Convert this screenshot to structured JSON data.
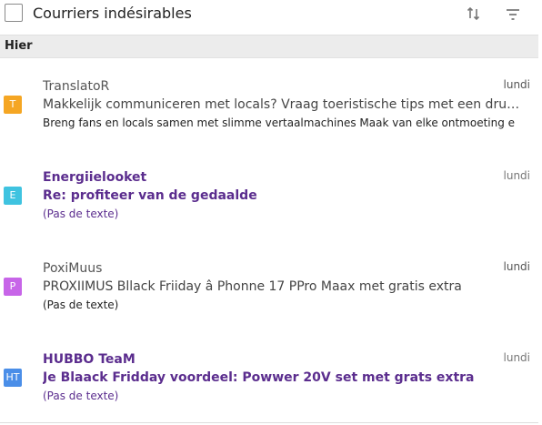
{
  "header": {
    "folder_title": "Courriers indésirables",
    "sort_icon": "sort-arrows-icon",
    "filter_icon": "filter-icon"
  },
  "group": {
    "label": "Hier"
  },
  "messages": [
    {
      "avatar_letter": "T",
      "avatar_color": "#f5a623",
      "sender": "TranslatoR",
      "subject": "Makkelijk communiceren met locals? Vraag toeristische tips met een druk op de knop",
      "preview": "Breng fans en locals samen met slimme vertaalmachines Maak van elke ontmoeting e",
      "date": "lundi",
      "unread": false
    },
    {
      "avatar_letter": "E",
      "avatar_color": "#3fc3e0",
      "sender": "Energiielooket",
      "subject": "Re: profiteer van de gedaalde",
      "preview": "(Pas de texte)",
      "date": "lundi",
      "unread": true
    },
    {
      "avatar_letter": "P",
      "avatar_color": "#c765e8",
      "sender": "PoxiMuus",
      "subject": "PROXIIMUS Bllack Friiday â Phonne 17 PPro Maax met gratis extra",
      "preview": "(Pas de texte)",
      "date": "lundi",
      "unread": false
    },
    {
      "avatar_letter": "HT",
      "avatar_color": "#4a8ee8",
      "sender": "HUBBO TeaM",
      "subject": "Je Blaack Fridday voordeel: Powwer 20V set met grats extra",
      "preview": "(Pas de texte)",
      "date": "lundi",
      "unread": true
    }
  ]
}
